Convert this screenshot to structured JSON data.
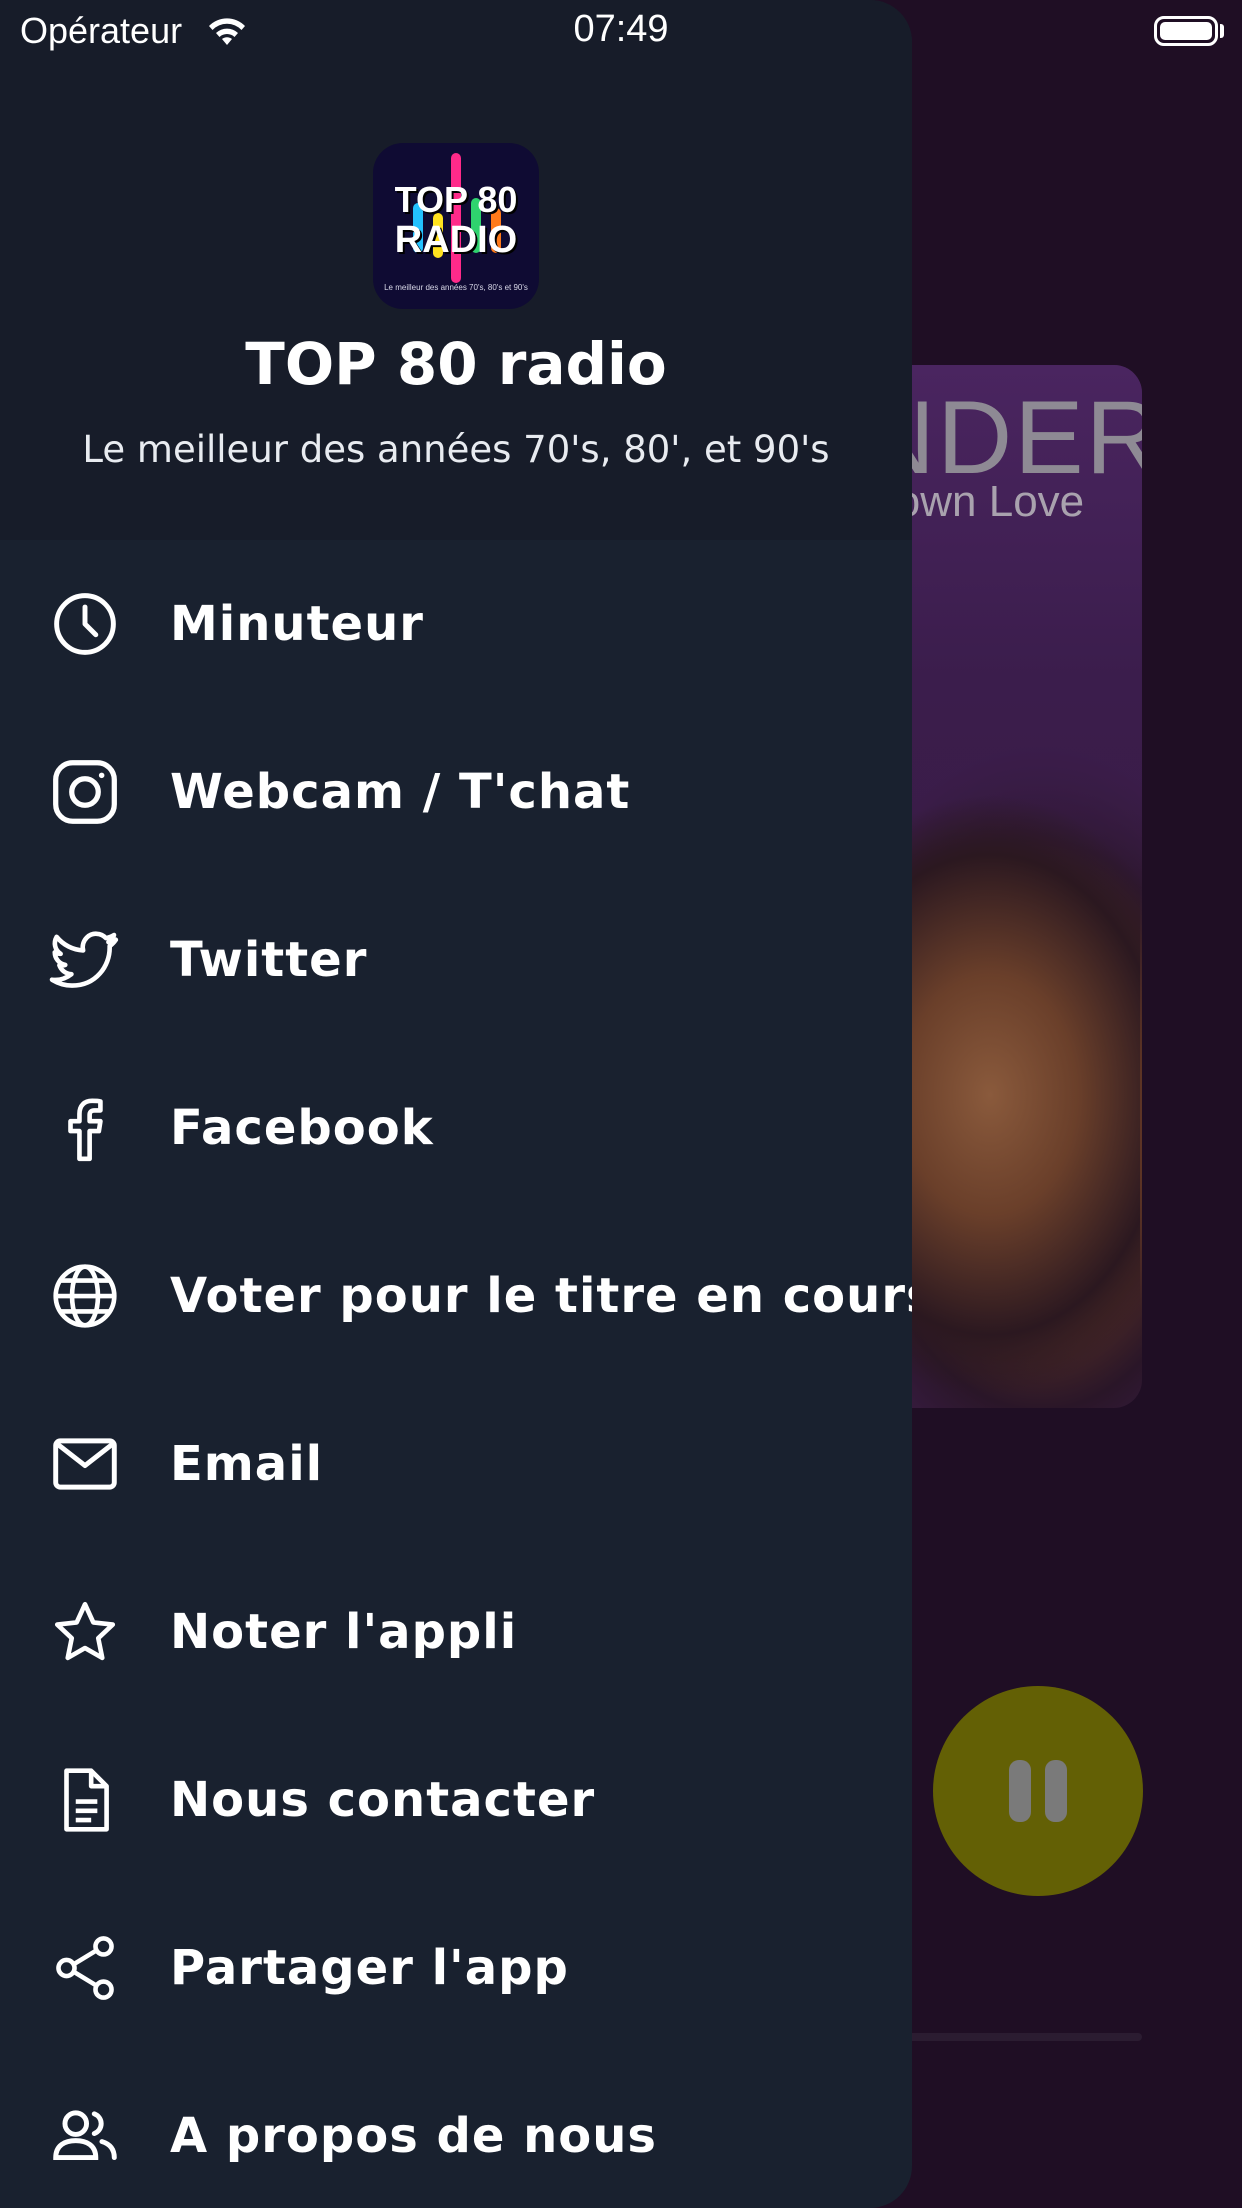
{
  "status_bar": {
    "carrier": "Opérateur",
    "time": "07:49"
  },
  "header": {
    "logo": {
      "line1": "TOP 80",
      "line2": "RADIO",
      "tagline": "Le meilleur des années 70's, 80's et 90's"
    },
    "title": "TOP 80 radio",
    "subtitle": "Le meilleur des années 70's, 80', et 90's"
  },
  "background": {
    "album_art_text_1": "NDER",
    "album_art_text_2": "Down Love",
    "play_button_color": "#636005"
  },
  "menu": {
    "items": [
      {
        "label": "Minuteur",
        "icon": "clock-icon"
      },
      {
        "label": "Webcam / T'chat",
        "icon": "instagram-icon"
      },
      {
        "label": "Twitter",
        "icon": "twitter-icon"
      },
      {
        "label": "Facebook",
        "icon": "facebook-icon"
      },
      {
        "label": "Voter pour le titre en cours",
        "icon": "globe-icon"
      },
      {
        "label": "Email",
        "icon": "mail-icon"
      },
      {
        "label": "Noter l'appli",
        "icon": "star-icon"
      },
      {
        "label": "Nous contacter",
        "icon": "document-icon"
      },
      {
        "label": "Partager l'app",
        "icon": "share-icon"
      },
      {
        "label": "A propos de nous",
        "icon": "users-icon"
      }
    ]
  },
  "colors": {
    "drawer": "#19212f",
    "drawer_header": "#171c29",
    "background": "#1f0e24"
  }
}
